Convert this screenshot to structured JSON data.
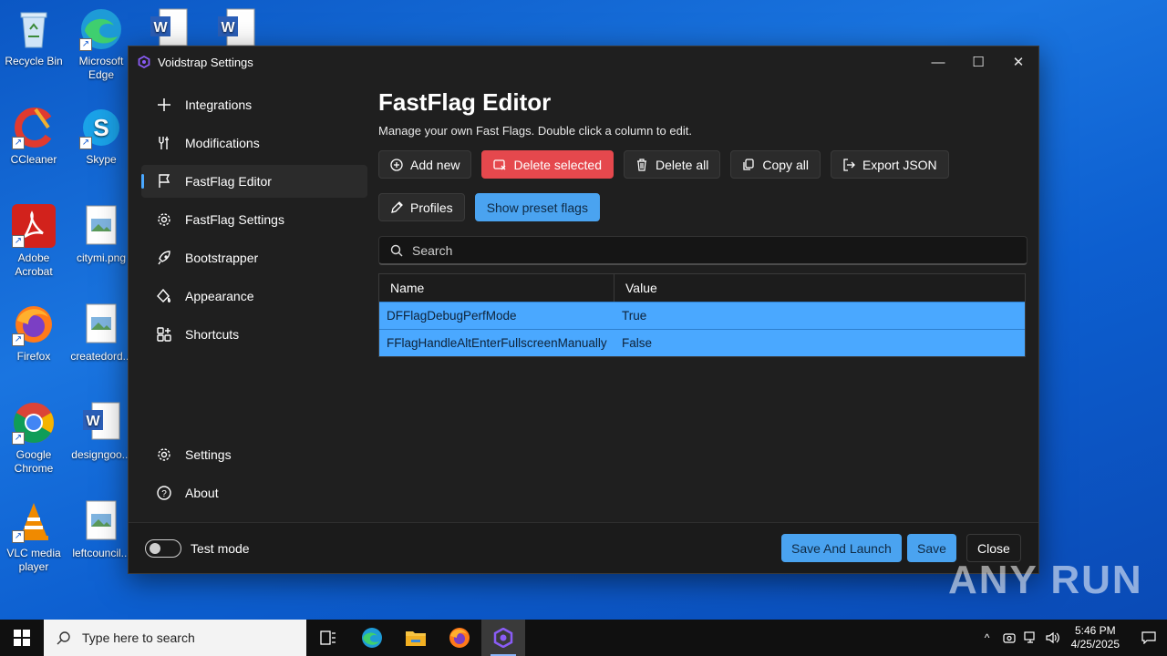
{
  "desktop": {
    "icons": [
      {
        "label": "Recycle Bin"
      },
      {
        "label": "Microsoft Edge"
      },
      {
        "label": "CCleaner"
      },
      {
        "label": "Skype"
      },
      {
        "label": "Adobe Acrobat"
      },
      {
        "label": "citymi.png"
      },
      {
        "label": "Firefox"
      },
      {
        "label": "createdord..."
      },
      {
        "label": "Google Chrome"
      },
      {
        "label": "designgoo..."
      },
      {
        "label": "VLC media player"
      },
      {
        "label": "leftcouncil..."
      }
    ],
    "watermark": "ANY RUN"
  },
  "window": {
    "title": "Voidstrap Settings",
    "controls": {
      "minimize": "—",
      "maximize": "☐",
      "close": "✕"
    }
  },
  "sidebar": {
    "items": [
      {
        "label": "Integrations",
        "icon": "plus-icon"
      },
      {
        "label": "Modifications",
        "icon": "wrench-icon"
      },
      {
        "label": "FastFlag Editor",
        "icon": "flag-icon",
        "active": true
      },
      {
        "label": "FastFlag Settings",
        "icon": "gear-icon"
      },
      {
        "label": "Bootstrapper",
        "icon": "rocket-icon"
      },
      {
        "label": "Appearance",
        "icon": "paint-bucket-icon"
      },
      {
        "label": "Shortcuts",
        "icon": "grid-add-icon"
      }
    ],
    "bottom": [
      {
        "label": "Settings",
        "icon": "gear-icon"
      },
      {
        "label": "About",
        "icon": "question-icon"
      }
    ]
  },
  "main": {
    "title": "FastFlag Editor",
    "description": "Manage your own Fast Flags. Double click a column to edit.",
    "toolbar": {
      "add_new": "Add new",
      "delete_selected": "Delete selected",
      "delete_all": "Delete all",
      "copy_all": "Copy all",
      "export_json": "Export JSON",
      "profiles": "Profiles",
      "show_preset_flags": "Show preset flags"
    },
    "search": {
      "placeholder": "Search"
    },
    "table": {
      "columns": [
        "Name",
        "Value"
      ],
      "rows": [
        {
          "name": "DFFlagDebugPerfMode",
          "value": "True"
        },
        {
          "name": "FFlagHandleAltEnterFullscreenManually",
          "value": "False"
        }
      ]
    }
  },
  "footer": {
    "test_mode_label": "Test mode",
    "test_mode_on": false,
    "save_and_launch": "Save And Launch",
    "save": "Save",
    "close": "Close"
  },
  "taskbar": {
    "search_placeholder": "Type here to search",
    "time": "5:46 PM",
    "date": "4/25/2025"
  },
  "colors": {
    "accent": "#4aa8ff",
    "danger": "#e5484d",
    "window_bg": "#1f1f1f"
  }
}
